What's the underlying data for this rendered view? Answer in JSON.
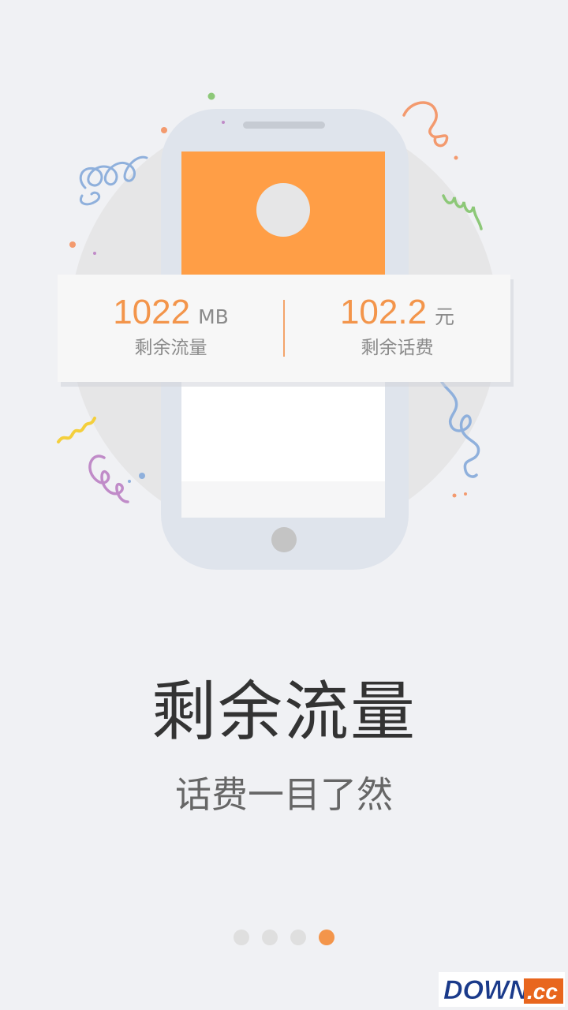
{
  "stats": {
    "data": {
      "value": "1022",
      "unit": "MB",
      "label": "剩余流量"
    },
    "balance": {
      "value": "102.2",
      "unit": "元",
      "label": "剩余话费"
    }
  },
  "headline": "剩余流量",
  "subheadline": "话费一目了然",
  "pager": {
    "total": 4,
    "active_index": 3
  },
  "watermark": {
    "text": "DOWN.cc"
  },
  "colors": {
    "accent": "#f3954b",
    "phone_screen": "#ff9e46",
    "background": "#f0f1f4"
  }
}
